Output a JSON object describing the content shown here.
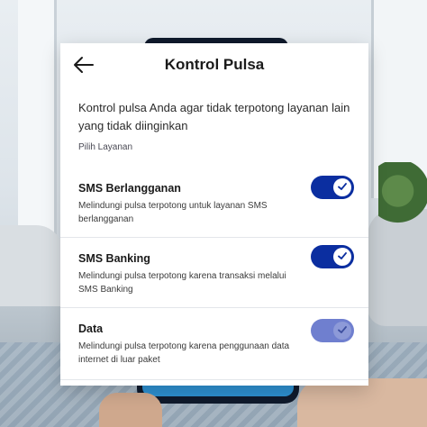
{
  "screen": {
    "title": "Kontrol Pulsa",
    "description": "Kontrol pulsa Anda agar tidak terpotong layanan lain yang tidak diinginkan",
    "section_label": "Pilih Layanan"
  },
  "services": [
    {
      "name": "SMS Berlangganan",
      "description": "Melindungi pulsa terpotong untuk layanan SMS berlangganan",
      "enabled": true,
      "state": "active"
    },
    {
      "name": "SMS Banking",
      "description": "Melindungi pulsa terpotong karena transaksi melalui SMS Banking",
      "enabled": true,
      "state": "active"
    },
    {
      "name": "Data",
      "description": "Melindungi pulsa terpotong karena penggunaan data internet di luar paket",
      "enabled": true,
      "state": "dimmed"
    }
  ],
  "colors": {
    "toggle_active": "#0b2ea0",
    "toggle_dimmed": "#6f7fcf",
    "check": "#0b2ea0",
    "check_dimmed": "#6f7fcf"
  },
  "icons": {
    "back": "arrow-left-icon",
    "toggle_check": "check-icon"
  }
}
